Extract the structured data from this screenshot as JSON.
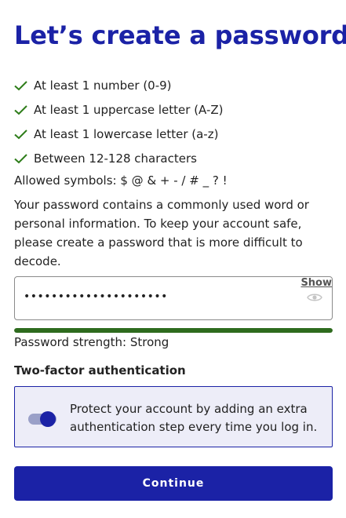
{
  "page": {
    "title": "Let’s create a password"
  },
  "requirements": [
    {
      "label": "At least 1 number (0-9)",
      "met": true
    },
    {
      "label": "At least 1 uppercase letter (A-Z)",
      "met": true
    },
    {
      "label": "At least 1 lowercase letter (a-z)",
      "met": true
    },
    {
      "label": "Between 12-128 characters",
      "met": true
    }
  ],
  "symbols_text": "Allowed symbols: $ @ & + - / # _ ? !",
  "warning_text": "Your password contains a commonly used word or personal information. To keep your account safe, please create a password that is more difficult to decode.",
  "password_field": {
    "value": "•••••••••••••••••••••",
    "show_label": "Show",
    "icon": "eye-icon"
  },
  "strength": {
    "fraction": 1.0,
    "color": "#2e6b1e",
    "label": "Password strength: Strong"
  },
  "two_factor": {
    "heading": "Two-factor authentication",
    "enabled": true,
    "description": "Protect your account by adding an extra authentication step every time you log in."
  },
  "continue_label": "Continue",
  "colors": {
    "brand": "#1b22a6",
    "check": "#2e7d1a"
  }
}
